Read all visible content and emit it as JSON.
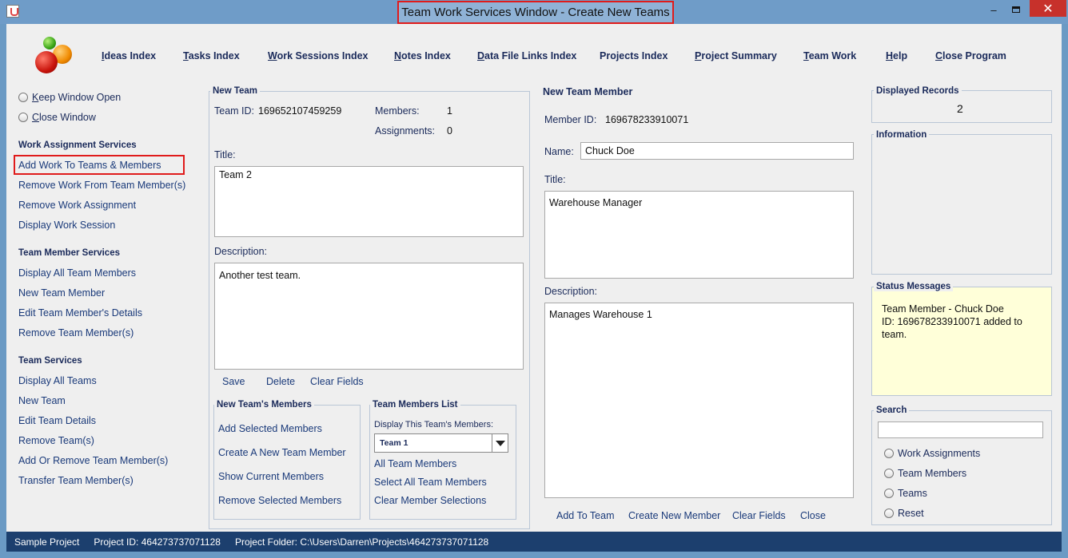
{
  "window": {
    "title": "Team Work Services Window - Create New Teams",
    "minimize": "‒",
    "close": "✕"
  },
  "menu": [
    {
      "label": "Ideas Index",
      "mn": "I",
      "rest": "deas Index"
    },
    {
      "label": "Tasks Index",
      "mn": "T",
      "rest": "asks Index"
    },
    {
      "label": "Work Sessions Index",
      "mn": "W",
      "rest": "ork Sessions Index"
    },
    {
      "label": "Notes Index",
      "mn": "N",
      "rest": "otes Index"
    },
    {
      "label": "Data File Links Index",
      "mn": "D",
      "rest": "ata File Links Index"
    },
    {
      "label": "Projects Index",
      "mn": "",
      "rest": "Projects Index"
    },
    {
      "label": "Project Summary",
      "mn": "P",
      "rest": "roject Summary"
    },
    {
      "label": "Team Work",
      "mn": "T",
      "rest": "eam Work"
    },
    {
      "label": "Help",
      "mn": "H",
      "rest": "elp"
    },
    {
      "label": "Close Program",
      "mn": "C",
      "rest": "lose Program"
    }
  ],
  "left": {
    "keep_open": {
      "mn": "K",
      "rest": "eep Window Open"
    },
    "close_window": {
      "mn": "C",
      "rest": "lose Window"
    },
    "work_section": "Work Assignment Services",
    "work_items": [
      "Add Work To Teams & Members",
      "Remove Work From Team Member(s)",
      "Remove Work Assignment",
      "Display Work Session"
    ],
    "member_section": "Team Member Services",
    "member_items": [
      "Display All Team Members",
      "New Team Member",
      "Edit Team Member's Details",
      "Remove Team Member(s)"
    ],
    "team_section": "Team Services",
    "team_items": [
      "Display All Teams",
      "New Team",
      "Edit Team Details",
      "Remove Team(s)",
      "Add Or Remove Team Member(s)",
      "Transfer Team Member(s)"
    ]
  },
  "new_team": {
    "title": "New Team",
    "id_label": "Team ID:",
    "id_value": "169652107459259",
    "members_label": "Members:",
    "members_value": "1",
    "assignments_label": "Assignments:",
    "assignments_value": "0",
    "title_label": "Title:",
    "title_value": "Team 2",
    "desc_label": "Description:",
    "desc_value": "Another test team.",
    "save": "Save",
    "delete": "Delete",
    "clear": "Clear Fields"
  },
  "team_members_box": {
    "title": "New Team's Members",
    "items": [
      "Add Selected Members",
      "Create A New Team Member",
      "Show Current Members",
      "Remove Selected Members"
    ]
  },
  "members_list": {
    "title": "Team Members List",
    "display_label": "Display This Team's Members:",
    "selected": "Team 1",
    "items": [
      "All Team Members",
      "Select All Team Members",
      "Clear Member Selections"
    ]
  },
  "new_member": {
    "title": "New Team Member",
    "id_label": "Member ID:",
    "id_value": "169678233910071",
    "name_label": "Name:",
    "name_value": "Chuck Doe",
    "title_label": "Title:",
    "title_value": "Warehouse Manager",
    "desc_label": "Description:",
    "desc_value": "Manages Warehouse 1",
    "add": "Add To Team",
    "create": "Create New Member",
    "clear": "Clear Fields",
    "close": "Close"
  },
  "right": {
    "displayed_title": "Displayed Records",
    "displayed_value": "2",
    "info_title": "Information",
    "status_title": "Status Messages",
    "status_lines": [
      "Team Member - Chuck Doe",
      "ID: 169678233910071 added to",
      "team."
    ],
    "search_title": "Search",
    "search_value": "",
    "search_options": [
      "Work Assignments",
      "Team Members",
      "Teams",
      "Reset"
    ]
  },
  "status_bar": {
    "project": "Sample Project",
    "project_id": "Project ID:  464273737071128",
    "folder": "Project Folder:  C:\\Users\\Darren\\Projects\\464273737071128"
  }
}
